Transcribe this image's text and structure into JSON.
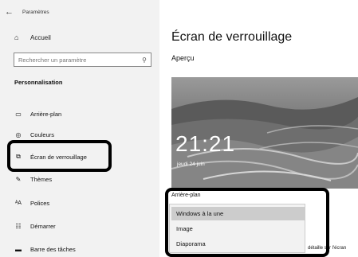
{
  "window": {
    "title": "Paramètres",
    "back_icon": "back-arrow-icon"
  },
  "sidebar": {
    "home_label": "Accueil",
    "search_placeholder": "Rechercher un paramètre",
    "section_title": "Personnalisation",
    "items": [
      {
        "label": "Arrière-plan",
        "icon": "picture-icon"
      },
      {
        "label": "Couleurs",
        "icon": "palette-icon"
      },
      {
        "label": "Écran de verrouillage",
        "icon": "lock-screen-icon",
        "selected": true
      },
      {
        "label": "Thèmes",
        "icon": "brush-icon"
      },
      {
        "label": "Polices",
        "icon": "fonts-icon"
      },
      {
        "label": "Démarrer",
        "icon": "start-icon"
      },
      {
        "label": "Barre des tâches",
        "icon": "taskbar-icon"
      }
    ]
  },
  "main": {
    "title": "Écran de verrouillage",
    "preview_label": "Aperçu",
    "preview": {
      "time": "21:21",
      "date": "jeudi 24 juin"
    },
    "background_label": "Arrière-plan",
    "dropdown_options": [
      "Windows à la une",
      "Image",
      "Diaporama"
    ],
    "dropdown_selected": "Windows à la une",
    "trailing_text": "détaille sur l'écran"
  },
  "colors": {
    "highlight_border": "#000000",
    "selected_option": "#cccccc",
    "sidebar_bg": "#f2f2f2"
  }
}
